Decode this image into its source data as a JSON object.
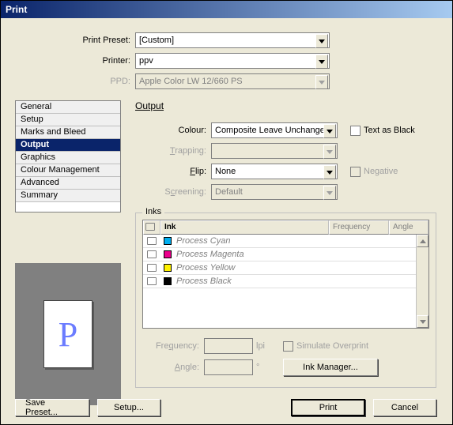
{
  "title": "Print",
  "top": {
    "preset_label": "Print Preset:",
    "preset_value": "[Custom]",
    "printer_label": "Printer:",
    "printer_value": "ppv",
    "ppd_label": "PPD:",
    "ppd_value": "Apple Color LW 12/660 PS"
  },
  "sidebar": {
    "items": [
      {
        "label": "General"
      },
      {
        "label": "Setup"
      },
      {
        "label": "Marks and Bleed"
      },
      {
        "label": "Output"
      },
      {
        "label": "Graphics"
      },
      {
        "label": "Colour Management"
      },
      {
        "label": "Advanced"
      },
      {
        "label": "Summary"
      }
    ],
    "selected": "Output"
  },
  "preview_glyph": "P",
  "main": {
    "title": "Output",
    "colour_label": "Colour:",
    "colour_value": "Composite Leave Unchange",
    "text_as_black": "Text as Black",
    "trapping_label": "Trapping:",
    "trapping_value": "",
    "flip_label": "Flip:",
    "flip_value": "None",
    "negative": "Negative",
    "screening_label": "Screening:",
    "screening_value": "Default"
  },
  "inks": {
    "legend": "Inks",
    "cols": {
      "ink": "Ink",
      "freq": "Frequency",
      "ang": "Angle"
    },
    "rows": [
      {
        "name": "Process Cyan",
        "color": "#00aeef"
      },
      {
        "name": "Process Magenta",
        "color": "#ec008c"
      },
      {
        "name": "Process Yellow",
        "color": "#fff200"
      },
      {
        "name": "Process Black",
        "color": "#000000"
      }
    ],
    "freq_label": "Frequency:",
    "freq_unit": "lpi",
    "angle_label": "Angle:",
    "angle_unit": "°",
    "simulate": "Simulate Overprint",
    "ink_manager": "Ink Manager..."
  },
  "buttons": {
    "save_preset": "Save Preset...",
    "setup": "Setup...",
    "print": "Print",
    "cancel": "Cancel"
  }
}
